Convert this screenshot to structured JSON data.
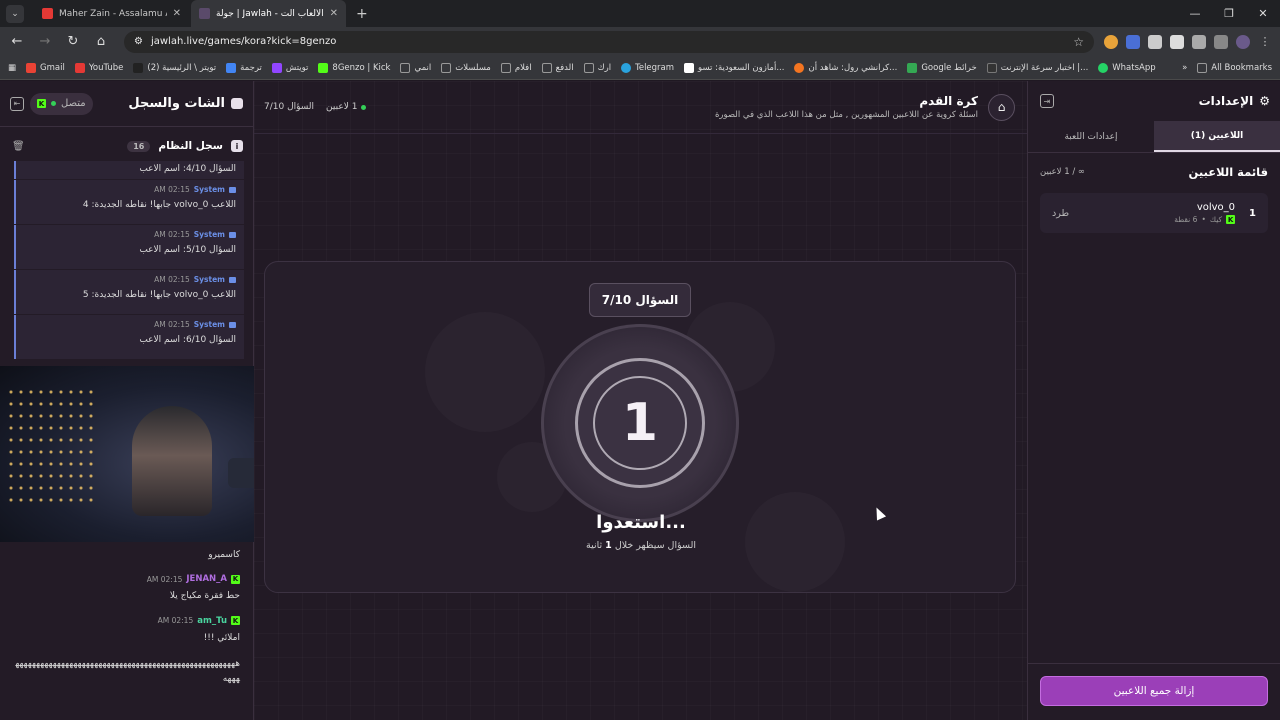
{
  "browser": {
    "tabs": [
      {
        "title": "Maher Zain - Assalamu Alayka",
        "color": "#e53935"
      },
      {
        "title": "جولة | Jawlah - منصة الألعاب الت...",
        "color": "#5a4a6a"
      }
    ],
    "url": "jawlah.live/games/kora?kick=8genzo",
    "bookmarks": [
      {
        "label": "Gmail",
        "color": "#ea4335"
      },
      {
        "label": "YouTube",
        "color": "#e53935"
      },
      {
        "label": "(2) تويتر \\ الرئيسية",
        "color": "#222222"
      },
      {
        "label": "ترجمة",
        "color": "#4285f4"
      },
      {
        "label": "تويتش",
        "color": "#9146ff"
      },
      {
        "label": "8Genzo | Kick",
        "color": "#53fc18"
      },
      {
        "label": "انمي",
        "color": "#888888"
      },
      {
        "label": "مسلسلات",
        "color": "#888888"
      },
      {
        "label": "افلام",
        "color": "#888888"
      },
      {
        "label": "الدفع",
        "color": "#888888"
      },
      {
        "label": "ارك",
        "color": "#888888"
      },
      {
        "label": "Telegram",
        "color": "#2aa3de"
      },
      {
        "label": "أمازون السعودية: تسو...",
        "color": "#ffffff"
      },
      {
        "label": "كرانشي رول: شاهد أن...",
        "color": "#f47521"
      },
      {
        "label": "Google خرائط",
        "color": "#34a853"
      },
      {
        "label": "اختبار سرعة الإنترنت |...",
        "color": "#333333"
      },
      {
        "label": "WhatsApp",
        "color": "#25d366"
      }
    ],
    "all_bookmarks": "All Bookmarks"
  },
  "chat": {
    "title": "الشات والسجل",
    "status": "متصل",
    "log_title": "سجل النظام",
    "log_count": "16",
    "system_logs": [
      {
        "sender": "",
        "time": "",
        "text": "السؤال 4/10: اسم الاعب"
      },
      {
        "sender": "System",
        "time": "02:15 AM",
        "text": "اللاعب volvo_0 جابها! نقاطه الجديدة: 4"
      },
      {
        "sender": "System",
        "time": "02:15 AM",
        "text": "السؤال 5/10: اسم الاعب"
      },
      {
        "sender": "System",
        "time": "02:15 AM",
        "text": "اللاعب volvo_0 جابها! نقاطه الجديدة: 5"
      },
      {
        "sender": "System",
        "time": "02:15 AM",
        "text": "السؤال 6/10: اسم الاعب"
      }
    ],
    "messages": [
      {
        "user": "",
        "time": "",
        "text": "كاسميرو",
        "color": "#dddddd"
      },
      {
        "user": "JENAN_A",
        "time": "02:15 AM",
        "text": "حط فقرة مكياج يلا",
        "color": "#b06ee0"
      },
      {
        "user": "am_Tu",
        "time": "02:15 AM",
        "text": "املائي !!!",
        "color": "#4ad6a0"
      },
      {
        "user": "",
        "time": "",
        "text": "هههههههههههههههههههههههههههههههههههههههههههههههههههههههههه",
        "color": "#dddddd"
      }
    ]
  },
  "game": {
    "title": "كرة القدم",
    "subtitle": "اسئلة كروية عن اللاعبين المشهورين , مثل من هذا اللاعب الذي في الصورة",
    "players_online": "1 لاعبين",
    "question_progress": "السؤال 7/10",
    "question_badge": "السؤال 7/10",
    "countdown": "1",
    "ready_text": "استعدوا...",
    "ready_sub_prefix": "السؤال سيظهر خلال",
    "ready_sub_num": "1",
    "ready_sub_suffix": "ثانية"
  },
  "settings": {
    "title": "الإعدادات",
    "tabs": [
      "اللاعبين (1)",
      "إعدادات اللعبة"
    ],
    "list_title": "قائمة اللاعبين",
    "list_count": "∞ / 1 لاعبين",
    "players": [
      {
        "rank": "1",
        "name": "volvo_0",
        "platform": "كيك",
        "points": "6 نقطة",
        "kick_label": "طرد"
      }
    ],
    "clear_button": "إزالة جميع اللاعبين"
  }
}
